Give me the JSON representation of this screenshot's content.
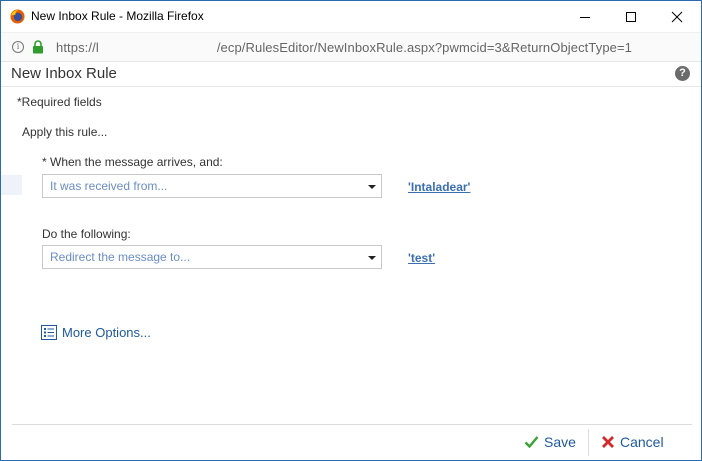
{
  "window": {
    "title": "New Inbox Rule - Mozilla Firefox",
    "url_prefix": "https://l",
    "url_path": "/ecp/RulesEditor/NewInboxRule.aspx?pwmcid=3&ReturnObjectType=1"
  },
  "page": {
    "title": "New Inbox Rule",
    "help_label": "?"
  },
  "form": {
    "required_note": "*Required fields",
    "apply_label": "Apply this rule...",
    "condition_label": "* When the message arrives, and:",
    "condition_select": "It was received from...",
    "condition_value": "'Intaladear'",
    "action_label": "Do the following:",
    "action_select": "Redirect the message to...",
    "action_value": "'test'",
    "more_options": "More Options..."
  },
  "footer": {
    "save_label": "Save",
    "cancel_label": "Cancel"
  },
  "colors": {
    "link": "#1e5a9e",
    "save_check": "#3aa335",
    "cancel_x": "#d22b2b",
    "window_border": "#2b6cb0"
  }
}
